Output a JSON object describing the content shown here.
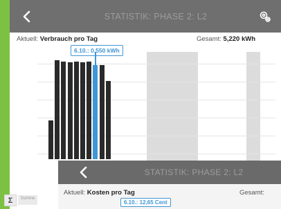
{
  "screen_back": {
    "title": "STATISTIK: PHASE 2: L2",
    "back_icon": "chevron-left-icon",
    "settings_icon": "gear-icon",
    "current_label": "Aktuell:",
    "current_value": "Verbrauch pro Tag",
    "total_label": "Gesamt:",
    "total_value": "5,220 kWh",
    "tooltip": "6.10.: 0,550 kWh",
    "chart": {
      "type": "bar",
      "bar_levels": [
        0.36,
        0.92,
        0.91,
        0.9,
        0.91,
        0.9,
        0.91,
        0.88,
        0.88,
        0.73
      ],
      "highlight_index": 7,
      "highlight_color": "#3f96d6",
      "bar_color": "#2a2a2a"
    }
  },
  "screen_front": {
    "title": "STATISTIK: PHASE 2: L2",
    "back_icon": "chevron-left-icon",
    "current_label": "Aktuell:",
    "current_value": "Kosten pro Tag",
    "total_label": "Gesamt:",
    "total_value": "",
    "tooltip": "6.10.: 12,65 Cent"
  },
  "side_controls": {
    "sum_symbol": "Σ",
    "sum_tab": "Summe"
  },
  "colors": {
    "background": "#7cc142",
    "navbar": "#6f6f6f",
    "accent": "#3f96d6"
  }
}
